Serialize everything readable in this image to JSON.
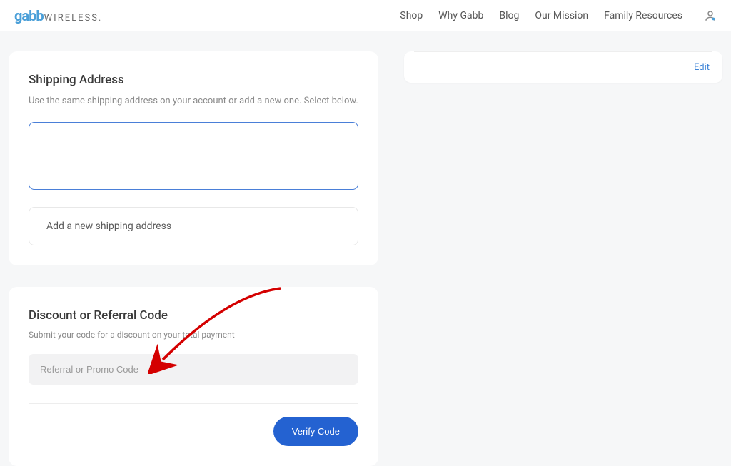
{
  "logo": {
    "brand": "gabb",
    "suffix": "WIRELESS."
  },
  "nav": {
    "shop": "Shop",
    "why": "Why Gabb",
    "blog": "Blog",
    "mission": "Our Mission",
    "resources": "Family Resources"
  },
  "shipping": {
    "title": "Shipping Address",
    "subtitle": "Use the same shipping address on your account or add a new one. Select below.",
    "add_new": "Add a new shipping address"
  },
  "discount": {
    "title": "Discount or Referral Code",
    "subtitle": "Submit your code for a discount on your total payment",
    "placeholder": "Referral or Promo Code",
    "verify": "Verify Code"
  },
  "summary": {
    "edit": "Edit"
  }
}
